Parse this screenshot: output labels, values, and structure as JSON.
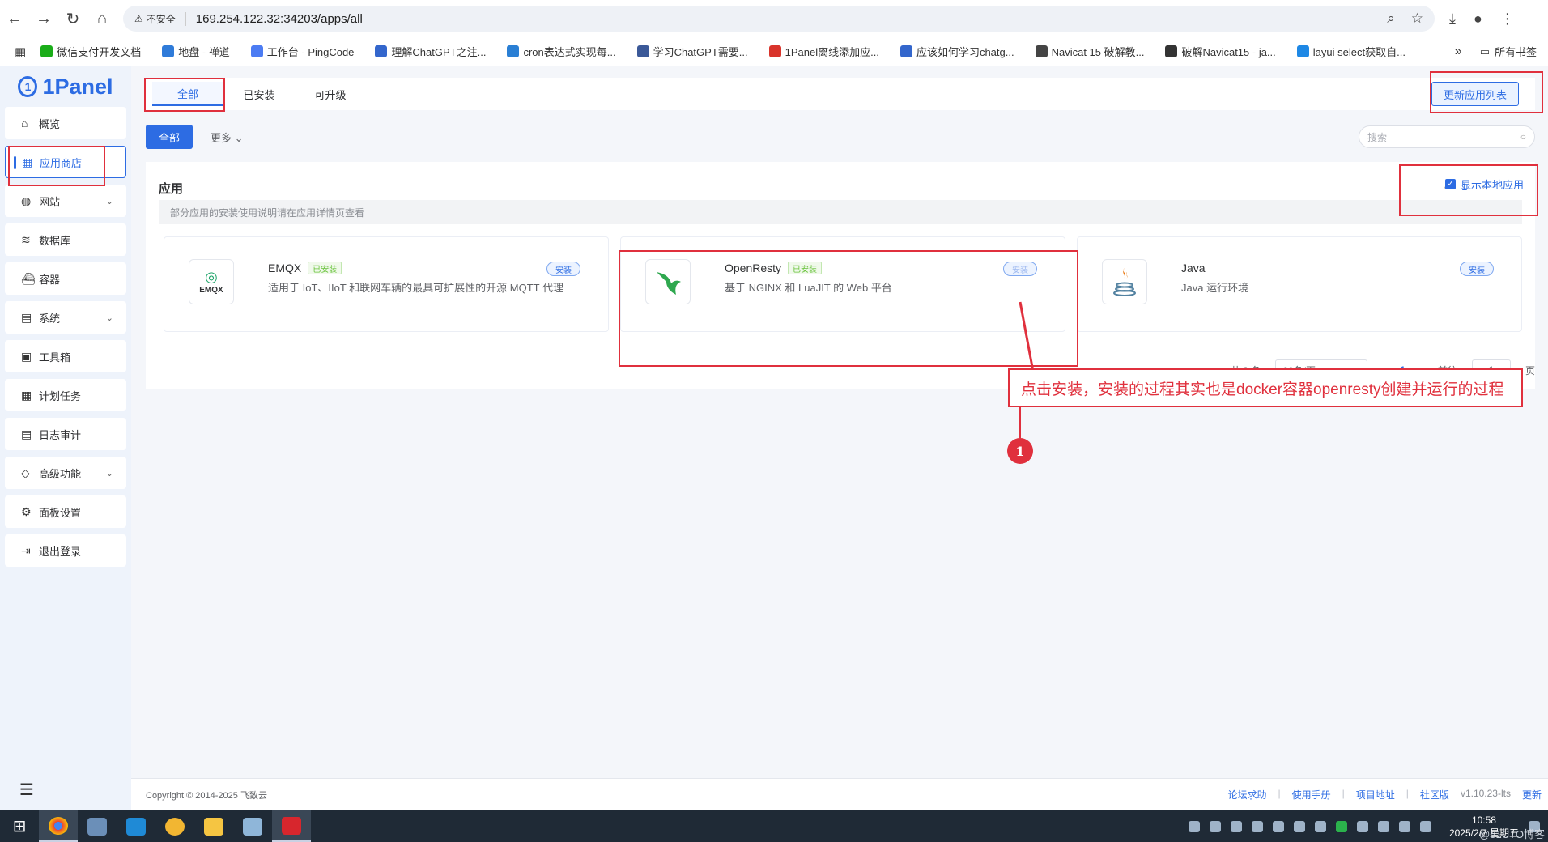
{
  "browser": {
    "security": "不安全",
    "url": "169.254.122.32:34203/apps/all",
    "bookmarks": [
      {
        "label": "微信支付开发文档",
        "color": "#1aad19"
      },
      {
        "label": "地盘 - 禅道",
        "color": "#2f7bd9"
      },
      {
        "label": "工作台 - PingCode",
        "color": "#4c7cf3"
      },
      {
        "label": "理解ChatGPT之注...",
        "color": "#3366cc"
      },
      {
        "label": "cron表达式实现每...",
        "color": "#2a7fd4"
      },
      {
        "label": "学习ChatGPT需要...",
        "color": "#3b5998"
      },
      {
        "label": "1Panel离线添加应...",
        "color": "#d9342b"
      },
      {
        "label": "应该如何学习chatg...",
        "color": "#3366cc"
      },
      {
        "label": "Navicat 15 破解教...",
        "color": "#444444"
      },
      {
        "label": "破解Navicat15 - ja...",
        "color": "#333333"
      },
      {
        "label": "layui select获取自...",
        "color": "#1e88e5"
      }
    ],
    "bookmarks_more": "»",
    "all_bookmarks": "所有书签"
  },
  "sidebar": {
    "logo": "1Panel",
    "items": [
      {
        "label": "概览",
        "icon": "home-icon",
        "chev": false
      },
      {
        "label": "应用商店",
        "icon": "grid-icon",
        "chev": false,
        "active": true
      },
      {
        "label": "网站",
        "icon": "globe-icon",
        "chev": true
      },
      {
        "label": "数据库",
        "icon": "database-icon",
        "chev": false
      },
      {
        "label": "容器",
        "icon": "container-icon",
        "chev": false
      },
      {
        "label": "系统",
        "icon": "system-icon",
        "chev": true
      },
      {
        "label": "工具箱",
        "icon": "toolbox-icon",
        "chev": false
      },
      {
        "label": "计划任务",
        "icon": "calendar-icon",
        "chev": false
      },
      {
        "label": "日志审计",
        "icon": "log-icon",
        "chev": false
      },
      {
        "label": "高级功能",
        "icon": "diamond-icon",
        "chev": true
      },
      {
        "label": "面板设置",
        "icon": "gear-icon",
        "chev": false
      },
      {
        "label": "退出登录",
        "icon": "logout-icon",
        "chev": false
      }
    ]
  },
  "tabs": [
    "全部",
    "已安装",
    "可升级"
  ],
  "refresh_button": "更新应用列表",
  "filter": {
    "all_label": "全部",
    "more_label": "更多",
    "search_placeholder": "搜索"
  },
  "panel": {
    "title": "应用",
    "page": "1",
    "show_local": "显示本地应用",
    "notice": "部分应用的安装使用说明请在应用详情页查看"
  },
  "apps": [
    {
      "name": "EMQX",
      "installed_tag": "已安装",
      "desc": "适用于 IoT、IIoT 和联网车辆的最具可扩展性的开源 MQTT 代理",
      "install": "安装",
      "logo_text": "EMQX"
    },
    {
      "name": "OpenResty",
      "installed_tag": "已安装",
      "desc": "基于 NGINX 和 LuaJIT 的 Web 平台",
      "install": "安装",
      "logo_text": ""
    },
    {
      "name": "Java",
      "installed_tag": "",
      "desc": "Java 运行环境",
      "install": "安装",
      "logo_text": ""
    }
  ],
  "pagination": {
    "total": "共 3 条",
    "page_size": "60条/页",
    "current": "1",
    "goto_label": "前往",
    "goto_value": "1",
    "page_suffix": "页"
  },
  "annotation": {
    "text": "点击安装，安装的过程其实也是docker容器openresty创建并运行的过程",
    "marker": "1"
  },
  "footer": {
    "copyright": "Copyright © 2014-2025 飞致云",
    "links": [
      "论坛求助",
      "使用手册",
      "项目地址",
      "社区版"
    ],
    "version": "v1.10.23-lts",
    "update": "更新"
  },
  "taskbar": {
    "time": "10:58",
    "date": "2025/2/7 星期五",
    "watermark": "@51CTO博客"
  }
}
